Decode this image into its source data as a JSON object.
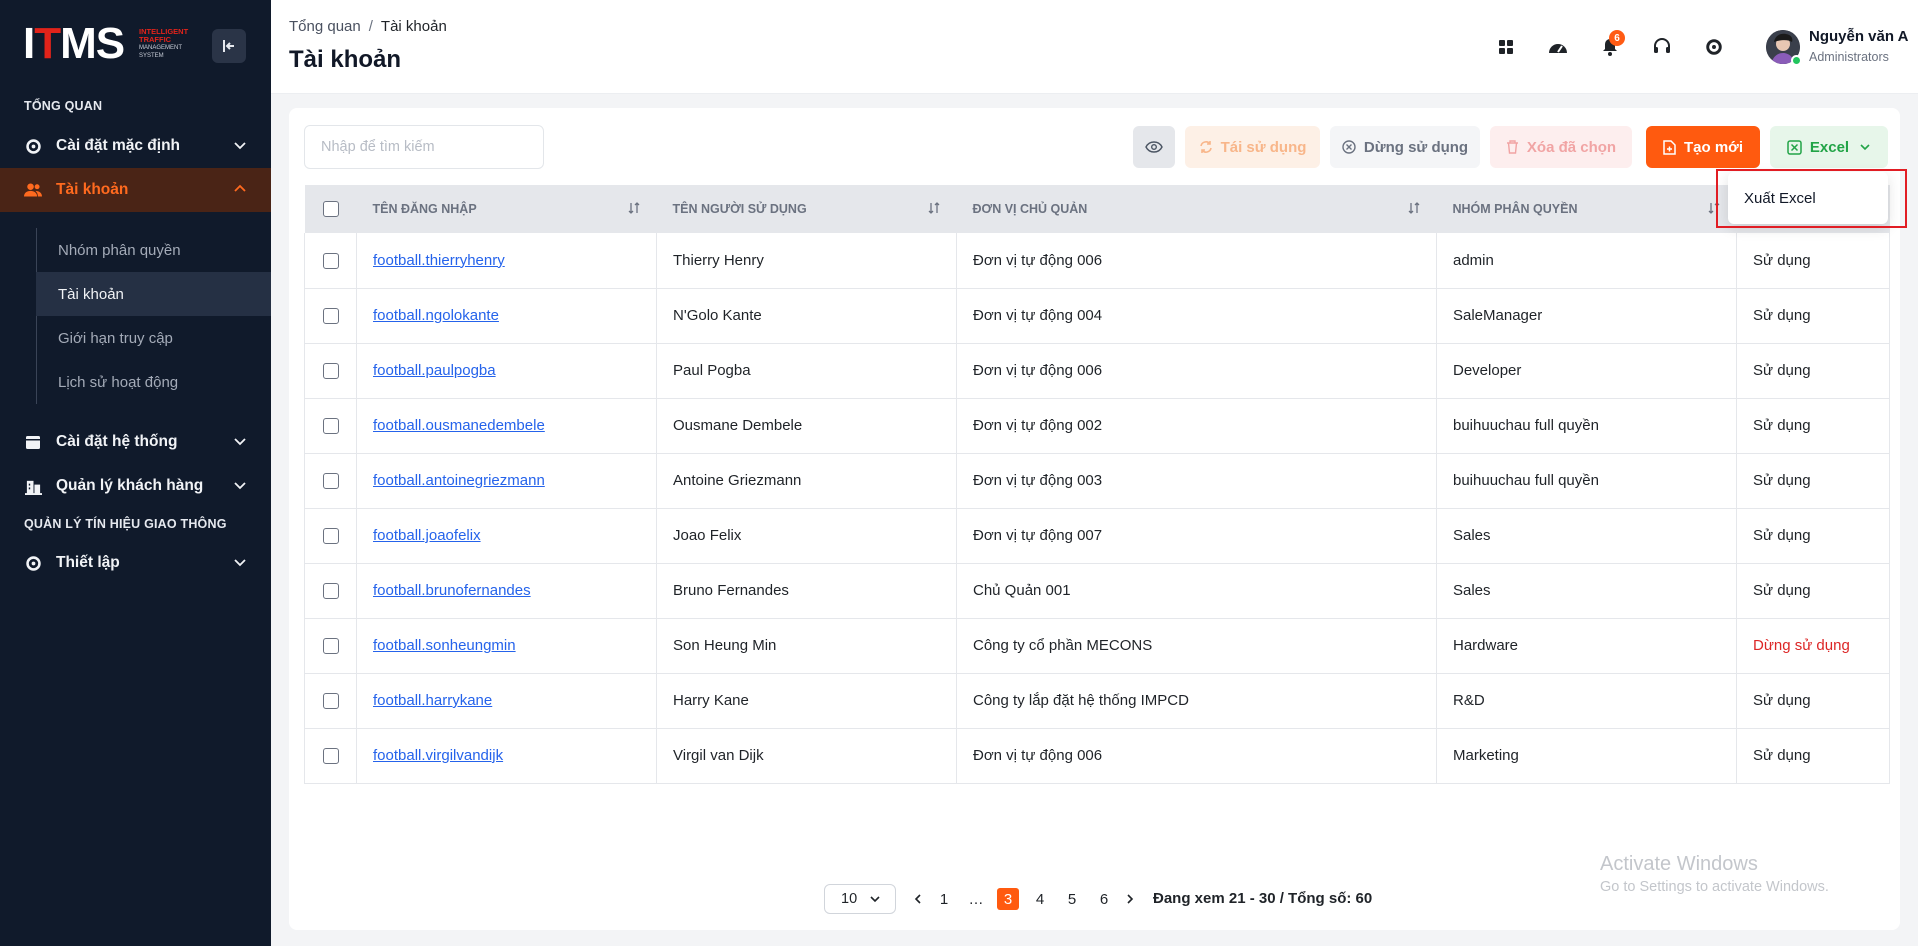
{
  "app": {
    "logo_mark": "ITMS",
    "logo_sub_1": "INTELLIGENT",
    "logo_sub_2": "TRAFFIC",
    "logo_sub_3": "MANAGEMENT",
    "logo_sub_4": "SYSTEM"
  },
  "sidebar": {
    "section_overview": "TỔNG QUAN",
    "section_traffic": "QUẢN LÝ TÍN HIỆU GIAO THÔNG",
    "items": [
      {
        "label": "Cài đặt mặc định",
        "icon": "gear-icon"
      },
      {
        "label": "Tài khoản",
        "icon": "users-icon"
      },
      {
        "label": "Cài đặt hệ thống",
        "icon": "calendar-icon"
      },
      {
        "label": "Quản lý khách hàng",
        "icon": "building-icon"
      },
      {
        "label": "Thiết lập",
        "icon": "gear-icon"
      }
    ],
    "subitems": [
      {
        "label": "Nhóm phân quyền"
      },
      {
        "label": "Tài khoản"
      },
      {
        "label": "Giới hạn truy cập"
      },
      {
        "label": "Lịch sử hoạt động"
      }
    ]
  },
  "header": {
    "breadcrumb_root": "Tổng quan",
    "breadcrumb_sep": "/",
    "breadcrumb_current": "Tài khoản",
    "title": "Tài khoản",
    "notif_count": "6",
    "user_name": "Nguyễn văn A",
    "user_role": "Administrators"
  },
  "toolbar": {
    "search_placeholder": "Nhập để tìm kiếm",
    "reuse_label": "Tái sử dụng",
    "stop_label": "Dừng sử dụng",
    "delete_label": "Xóa đã chọn",
    "new_label": "Tạo mới",
    "excel_label": "Excel"
  },
  "dropdown": {
    "export_label": "Xuất Excel"
  },
  "table": {
    "headers": [
      "TÊN ĐĂNG NHẬP",
      "TÊN NGƯỜI SỬ DỤNG",
      "ĐƠN VỊ CHỦ QUẢN",
      "NHÓM PHÂN QUYỀN"
    ],
    "rows": [
      {
        "username": "football.thierryhenry",
        "name": "Thierry Henry",
        "unit": "Đơn vị tự động 006",
        "group": "admin",
        "status": "Sử dụng"
      },
      {
        "username": "football.ngolokante",
        "name": "N'Golo Kante",
        "unit": "Đơn vị tự động 004",
        "group": "SaleManager",
        "status": "Sử dụng"
      },
      {
        "username": "football.paulpogba",
        "name": "Paul Pogba",
        "unit": "Đơn vị tự động 006",
        "group": "Developer",
        "status": "Sử dụng"
      },
      {
        "username": "football.ousmanedembele",
        "name": "Ousmane Dembele",
        "unit": "Đơn vị tự động 002",
        "group": "buihuuchau full quyền",
        "status": "Sử dụng"
      },
      {
        "username": "football.antoinegriezmann",
        "name": "Antoine Griezmann",
        "unit": "Đơn vị tự động 003",
        "group": "buihuuchau full quyền",
        "status": "Sử dụng"
      },
      {
        "username": "football.joaofelix",
        "name": "Joao Felix",
        "unit": "Đơn vị tự động 007",
        "group": "Sales",
        "status": "Sử dụng"
      },
      {
        "username": "football.brunofernandes",
        "name": "Bruno Fernandes",
        "unit": "Chủ Quản 001",
        "group": "Sales",
        "status": "Sử dụng"
      },
      {
        "username": "football.sonheungmin",
        "name": "Son Heung Min",
        "unit": "Công ty cổ phần MECONS",
        "group": "Hardware",
        "status": "Dừng sử dụng"
      },
      {
        "username": "football.harrykane",
        "name": "Harry Kane",
        "unit": "Công ty lắp đặt hệ thống IMPCD",
        "group": "R&D",
        "status": "Sử dụng"
      },
      {
        "username": "football.virgilvandijk",
        "name": "Virgil van Dijk",
        "unit": "Đơn vị tự động 006",
        "group": "Marketing",
        "status": "Sử dụng"
      }
    ]
  },
  "pagination": {
    "page_size": "10",
    "pages": [
      "1",
      "…",
      "3",
      "4",
      "5",
      "6"
    ],
    "current_page": "3",
    "info": "Đang xem 21 - 30 / Tổng số: 60"
  },
  "watermark": {
    "line1": "Activate Windows",
    "line2": "Go to Settings to activate Windows."
  },
  "colors": {
    "accent": "#ff5a0f",
    "sidebar_bg": "#101a2b",
    "link": "#2563eb",
    "danger": "#dc2626",
    "excel_green": "#22a447"
  }
}
